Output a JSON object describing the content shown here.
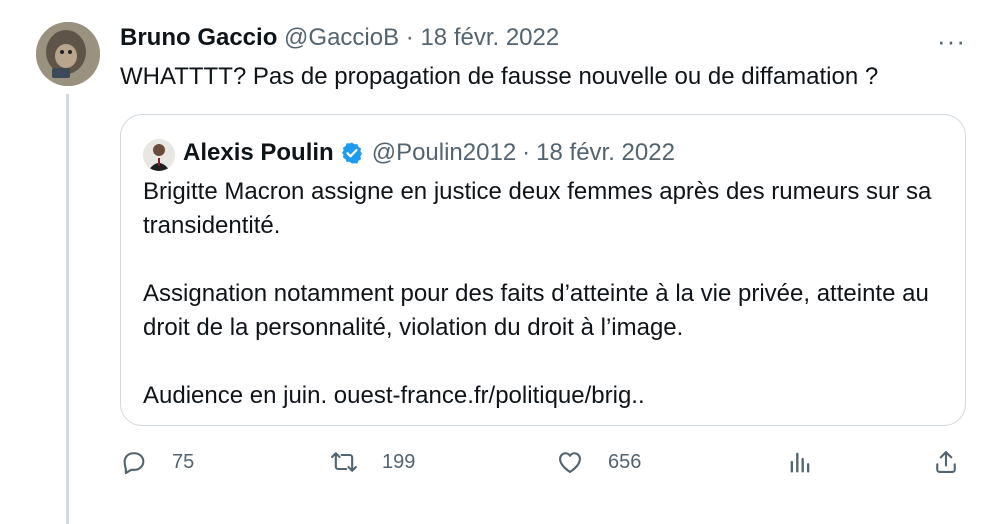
{
  "tweet": {
    "author_name": "Bruno Gaccio",
    "author_handle": "@GaccioB",
    "separator": "·",
    "date": "18 févr. 2022",
    "more_label": "···",
    "text": "WHATTTT? Pas de propagation de fausse nouvelle ou de diffamation ?"
  },
  "quoted": {
    "author_name": "Alexis Poulin",
    "author_handle": "@Poulin2012",
    "separator": "·",
    "date": "18 févr. 2022",
    "verified": true,
    "paragraphs": [
      "Brigitte Macron assigne en justice deux femmes après des rumeurs sur sa transidentité.",
      "Assignation notamment pour des faits d’atteinte à la vie privée, atteinte au droit de la personnalité, violation du droit à l’image.",
      "Audience en juin. ouest-france.fr/politique/brig.."
    ]
  },
  "actions": {
    "reply_count": "75",
    "retweet_count": "199",
    "like_count": "656"
  },
  "colors": {
    "text": "#0f1419",
    "muted": "#536471",
    "border": "#cfd9de",
    "verified": "#1d9bf0"
  }
}
